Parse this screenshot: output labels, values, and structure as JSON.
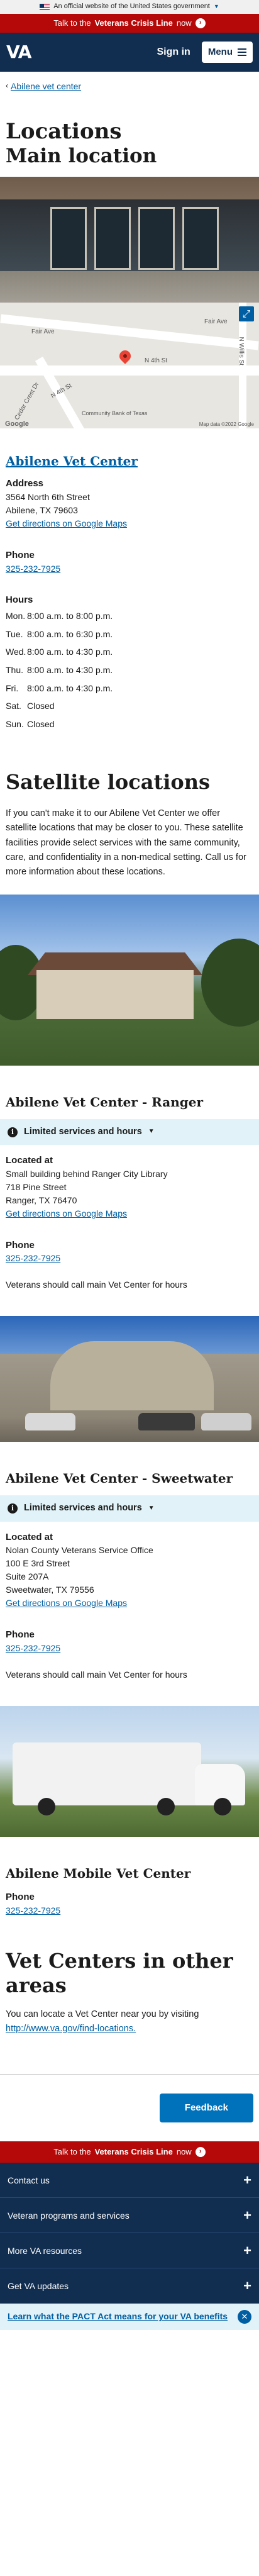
{
  "gov_banner": {
    "text": "An official website of the United States government"
  },
  "crisis": {
    "prefix": "Talk to the",
    "bold": "Veterans Crisis Line",
    "suffix": "now"
  },
  "header": {
    "logo": "VA",
    "signin": "Sign in",
    "menu": "Menu"
  },
  "breadcrumb": {
    "label": "Abilene vet center"
  },
  "page": {
    "title": "Locations",
    "main_heading": "Main location"
  },
  "map": {
    "labels": [
      "Fair Ave",
      "Fair Ave",
      "N 4th St",
      "N 4th St",
      "Cedar Crest Dr",
      "N Willis St",
      "Community Bank of Texas",
      "Google",
      "Map data ©2022 Google"
    ]
  },
  "main_location": {
    "name": "Abilene Vet Center",
    "address_label": "Address",
    "address": [
      "3564 North 6th Street",
      "Abilene, TX 79603"
    ],
    "directions": "Get directions on Google Maps",
    "phone_label": "Phone",
    "phone": "325-232-7925",
    "hours_label": "Hours",
    "hours": [
      {
        "day": "Mon.",
        "time": "8:00 a.m. to 8:00 p.m."
      },
      {
        "day": "Tue.",
        "time": "8:00 a.m. to 6:30 p.m."
      },
      {
        "day": "Wed.",
        "time": "8:00 a.m. to 4:30 p.m."
      },
      {
        "day": "Thu.",
        "time": "8:00 a.m. to 4:30 p.m."
      },
      {
        "day": "Fri.",
        "time": "8:00 a.m. to 4:30 p.m."
      },
      {
        "day": "Sat.",
        "time": "Closed"
      },
      {
        "day": "Sun.",
        "time": "Closed"
      }
    ]
  },
  "satellite": {
    "heading": "Satellite locations",
    "intro": "If you can't make it to our Abilene Vet Center we offer satellite locations that may be closer to you. These satellite facilities provide select services with the same community, care, and confidentiality in a non-medical setting. Call us for more information about these locations."
  },
  "ranger": {
    "name": "Abilene Vet Center - Ranger",
    "alert": "Limited services and hours",
    "located_label": "Located at",
    "address": [
      "Small building behind Ranger City Library",
      "718 Pine Street",
      "Ranger, TX 76470"
    ],
    "directions": "Get directions on Google Maps",
    "phone_label": "Phone",
    "phone": "325-232-7925",
    "note": "Veterans should call main Vet Center for hours"
  },
  "sweetwater": {
    "name": "Abilene Vet Center - Sweetwater",
    "alert": "Limited services and hours",
    "located_label": "Located at",
    "address": [
      "Nolan County Veterans Service Office",
      "100 E 3rd Street",
      "Suite 207A",
      "Sweetwater, TX 79556"
    ],
    "directions": "Get directions on Google Maps",
    "phone_label": "Phone",
    "phone": "325-232-7925",
    "note": "Veterans should call main Vet Center for hours"
  },
  "mobile": {
    "name": "Abilene Mobile Vet Center",
    "phone_label": "Phone",
    "phone": "325-232-7925"
  },
  "other_areas": {
    "heading": "Vet Centers in other areas",
    "text": "You can locate a Vet Center near you by visiting",
    "link": "http://www.va.gov/find-locations."
  },
  "feedback": "Feedback",
  "footer": {
    "items": [
      "Contact us",
      "Veteran programs and services",
      "More VA resources",
      "Get VA updates"
    ],
    "pact": "Learn what the PACT Act means for your VA benefits"
  },
  "colors": {
    "navy": "#112e51",
    "crisis_red": "#b50909",
    "link": "#005ea2",
    "alert_bg": "#e1f3f8"
  }
}
